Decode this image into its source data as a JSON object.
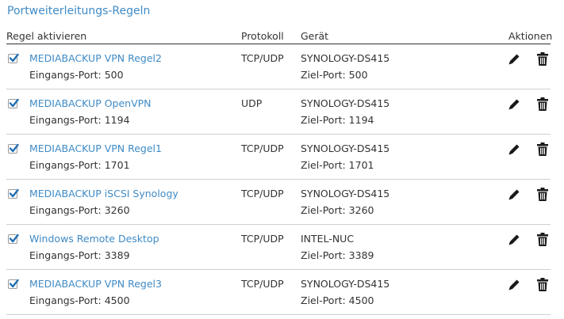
{
  "page": {
    "title": "Portweiterleitungs-Regeln"
  },
  "table": {
    "headers": {
      "activate": "Regel aktivieren",
      "protocol": "Protokoll",
      "device": "Gerät",
      "actions": "Aktionen"
    },
    "rows": [
      {
        "checked": true,
        "name": "MEDIABACKUP VPN Regel2",
        "in_port": "Eingangs-Port: 500",
        "protocol": "TCP/UDP",
        "device": "SYNOLOGY-DS415",
        "out_port": "Ziel-Port: 500"
      },
      {
        "checked": true,
        "name": "MEDIABACKUP OpenVPN",
        "in_port": "Eingangs-Port: 1194",
        "protocol": "UDP",
        "device": "SYNOLOGY-DS415",
        "out_port": "Ziel-Port: 1194"
      },
      {
        "checked": true,
        "name": "MEDIABACKUP VPN Regel1",
        "in_port": "Eingangs-Port: 1701",
        "protocol": "TCP/UDP",
        "device": "SYNOLOGY-DS415",
        "out_port": "Ziel-Port: 1701"
      },
      {
        "checked": true,
        "name": "MEDIABACKUP iSCSI Synology",
        "in_port": "Eingangs-Port: 3260",
        "protocol": "TCP/UDP",
        "device": "SYNOLOGY-DS415",
        "out_port": "Ziel-Port: 3260"
      },
      {
        "checked": true,
        "name": "Windows Remote Desktop",
        "in_port": "Eingangs-Port: 3389",
        "protocol": "TCP/UDP",
        "device": "INTEL-NUC",
        "out_port": "Ziel-Port: 3389"
      },
      {
        "checked": true,
        "name": "MEDIABACKUP VPN Regel3",
        "in_port": "Eingangs-Port: 4500",
        "protocol": "TCP/UDP",
        "device": "SYNOLOGY-DS415",
        "out_port": "Ziel-Port: 4500"
      }
    ]
  },
  "icons": {
    "edit": "pencil-icon",
    "delete": "trash-icon",
    "check": "checkmark-icon"
  },
  "colors": {
    "link": "#3f8bc6",
    "checkmark": "#1f6fb4",
    "text": "#333333",
    "icon": "#1a1a1a"
  }
}
